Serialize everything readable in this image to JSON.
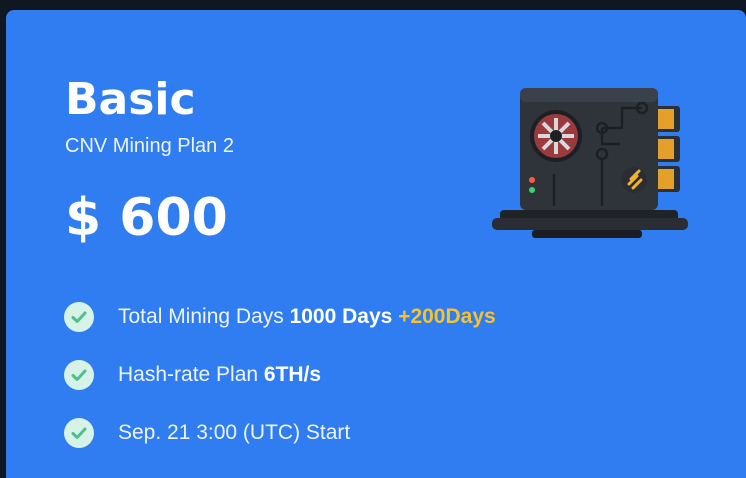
{
  "plan": {
    "title": "Basic",
    "subtitle": "CNV Mining Plan 2",
    "price": "$ 600"
  },
  "features": [
    {
      "label": "Total Mining Days",
      "value": "1000 Days",
      "bonus": "+200Days"
    },
    {
      "label": "Hash-rate Plan",
      "value": "6TH/s"
    },
    {
      "label": "Sep. 21 3:00 (UTC) Start"
    }
  ],
  "icons": {
    "check": "check-circle-icon",
    "miner": "mining-rig-illustration"
  },
  "colors": {
    "card": "#2f7df1",
    "bonus": "#f5c230",
    "check_bg": "#d7f2e6",
    "check_mark": "#4fc08d"
  }
}
